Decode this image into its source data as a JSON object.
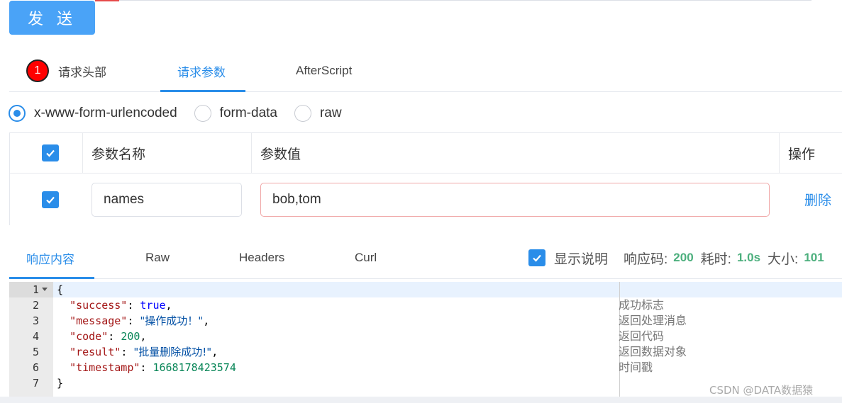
{
  "toolbar": {
    "send_label": "发 送"
  },
  "request_tabs": [
    {
      "label": "请求头部",
      "badge": "1"
    },
    {
      "label": "请求参数",
      "active": true
    },
    {
      "label": "AfterScript"
    }
  ],
  "body_types": [
    {
      "label": "x-www-form-urlencoded",
      "checked": true
    },
    {
      "label": "form-data",
      "checked": false
    },
    {
      "label": "raw",
      "checked": false
    }
  ],
  "params_table": {
    "headers": {
      "name": "参数名称",
      "value": "参数值",
      "action": "操作"
    },
    "rows": [
      {
        "checked": true,
        "name": "names",
        "value": "bob,tom",
        "action": "删除"
      }
    ]
  },
  "response_tabs": [
    {
      "label": "响应内容",
      "active": true
    },
    {
      "label": "Raw"
    },
    {
      "label": "Headers"
    },
    {
      "label": "Curl"
    }
  ],
  "response_meta": {
    "show_desc_label": "显示说明",
    "show_desc_checked": true,
    "code_label": "响应码:",
    "code_value": "200",
    "time_label": "耗时:",
    "time_value": "1.0s",
    "size_label": "大小:",
    "size_value": "101"
  },
  "editor": {
    "line_numbers": [
      "1",
      "2",
      "3",
      "4",
      "5",
      "6",
      "7"
    ],
    "lines": {
      "l1": "{",
      "l2_key": "\"success\"",
      "l2_val": "true",
      "l3_key": "\"message\"",
      "l3_val": "\"操作成功！\"",
      "l4_key": "\"code\"",
      "l4_val": "200",
      "l5_key": "\"result\"",
      "l5_val": "\"批量删除成功!\"",
      "l6_key": "\"timestamp\"",
      "l6_val": "1668178423574",
      "l7": "}"
    },
    "comments": [
      "成功标志",
      "返回处理消息",
      "返回代码",
      "返回数据对象",
      "时间戳"
    ]
  },
  "watermark": "CSDN @DATA数据猿",
  "colors": {
    "accent": "#2a8de9",
    "send_button": "#4aa3f7",
    "badge": "#ff0000",
    "metric_value": "#4caf7d"
  }
}
